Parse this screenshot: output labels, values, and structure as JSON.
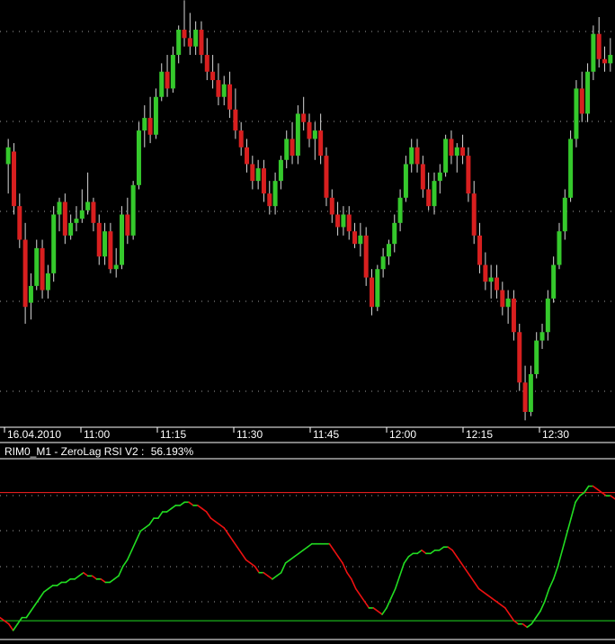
{
  "indicator": {
    "title": "RIM0_M1 - ZeroLag RSI V2 :",
    "value": "56.193%"
  },
  "colors": {
    "background": "#000000",
    "bull": "#35c92c",
    "bear": "#d81f1f",
    "wick": "#d8d8d8",
    "grid": "#c8c8c8",
    "rsi_up": "#22dd22",
    "rsi_down": "#ee1111",
    "level_upper": "#ff2020",
    "level_lower": "#22dd22",
    "axis": "#ffffff"
  },
  "chart_data": [
    {
      "type": "candlestick",
      "symbol": "RIM0",
      "timeframe": "M1",
      "x_tick_labels": [
        "16.04.2010",
        "11:00",
        "11:15",
        "11:30",
        "11:45",
        "12:00",
        "12:15",
        "12:30"
      ],
      "y_axis": "price (unlabeled)",
      "grid": true,
      "ylim": [
        0,
        100
      ],
      "candles": [
        {
          "o": 62,
          "h": 68,
          "l": 55,
          "c": 66
        },
        {
          "o": 65,
          "h": 67,
          "l": 50,
          "c": 52
        },
        {
          "o": 52,
          "h": 55,
          "l": 42,
          "c": 44
        },
        {
          "o": 44,
          "h": 48,
          "l": 24,
          "c": 28
        },
        {
          "o": 29,
          "h": 36,
          "l": 25,
          "c": 33
        },
        {
          "o": 33,
          "h": 44,
          "l": 32,
          "c": 42
        },
        {
          "o": 42,
          "h": 44,
          "l": 30,
          "c": 32
        },
        {
          "o": 32,
          "h": 38,
          "l": 30,
          "c": 36
        },
        {
          "o": 36,
          "h": 52,
          "l": 34,
          "c": 50
        },
        {
          "o": 50,
          "h": 54,
          "l": 46,
          "c": 53
        },
        {
          "o": 53,
          "h": 55,
          "l": 43,
          "c": 45
        },
        {
          "o": 45,
          "h": 50,
          "l": 44,
          "c": 48
        },
        {
          "o": 48,
          "h": 52,
          "l": 46,
          "c": 49
        },
        {
          "o": 49,
          "h": 56,
          "l": 48,
          "c": 51
        },
        {
          "o": 51,
          "h": 60,
          "l": 50,
          "c": 53
        },
        {
          "o": 53,
          "h": 54,
          "l": 46,
          "c": 48
        },
        {
          "o": 48,
          "h": 50,
          "l": 38,
          "c": 40
        },
        {
          "o": 40,
          "h": 48,
          "l": 38,
          "c": 46
        },
        {
          "o": 46,
          "h": 48,
          "l": 36,
          "c": 37
        },
        {
          "o": 37,
          "h": 42,
          "l": 35,
          "c": 38
        },
        {
          "o": 38,
          "h": 52,
          "l": 37,
          "c": 50
        },
        {
          "o": 50,
          "h": 54,
          "l": 43,
          "c": 45
        },
        {
          "o": 45,
          "h": 58,
          "l": 44,
          "c": 57
        },
        {
          "o": 57,
          "h": 72,
          "l": 56,
          "c": 70
        },
        {
          "o": 70,
          "h": 76,
          "l": 66,
          "c": 73
        },
        {
          "o": 73,
          "h": 78,
          "l": 67,
          "c": 69
        },
        {
          "o": 69,
          "h": 80,
          "l": 68,
          "c": 78
        },
        {
          "o": 78,
          "h": 86,
          "l": 77,
          "c": 84
        },
        {
          "o": 84,
          "h": 88,
          "l": 78,
          "c": 80
        },
        {
          "o": 80,
          "h": 90,
          "l": 79,
          "c": 88
        },
        {
          "o": 88,
          "h": 95,
          "l": 86,
          "c": 94
        },
        {
          "o": 94,
          "h": 101,
          "l": 90,
          "c": 92
        },
        {
          "o": 92,
          "h": 98,
          "l": 88,
          "c": 90
        },
        {
          "o": 90,
          "h": 96,
          "l": 88,
          "c": 94
        },
        {
          "o": 94,
          "h": 96,
          "l": 86,
          "c": 88
        },
        {
          "o": 88,
          "h": 92,
          "l": 82,
          "c": 84
        },
        {
          "o": 84,
          "h": 88,
          "l": 80,
          "c": 82
        },
        {
          "o": 82,
          "h": 86,
          "l": 76,
          "c": 78
        },
        {
          "o": 78,
          "h": 83,
          "l": 76,
          "c": 81
        },
        {
          "o": 81,
          "h": 84,
          "l": 73,
          "c": 75
        },
        {
          "o": 75,
          "h": 80,
          "l": 68,
          "c": 70
        },
        {
          "o": 70,
          "h": 72,
          "l": 64,
          "c": 66
        },
        {
          "o": 66,
          "h": 68,
          "l": 60,
          "c": 62
        },
        {
          "o": 62,
          "h": 64,
          "l": 56,
          "c": 58
        },
        {
          "o": 58,
          "h": 63,
          "l": 56,
          "c": 61
        },
        {
          "o": 61,
          "h": 63,
          "l": 53,
          "c": 55
        },
        {
          "o": 55,
          "h": 58,
          "l": 50,
          "c": 52
        },
        {
          "o": 52,
          "h": 60,
          "l": 50,
          "c": 58
        },
        {
          "o": 58,
          "h": 64,
          "l": 56,
          "c": 63
        },
        {
          "o": 63,
          "h": 70,
          "l": 61,
          "c": 68
        },
        {
          "o": 68,
          "h": 72,
          "l": 62,
          "c": 64
        },
        {
          "o": 64,
          "h": 76,
          "l": 62,
          "c": 74
        },
        {
          "o": 74,
          "h": 78,
          "l": 70,
          "c": 72
        },
        {
          "o": 72,
          "h": 74,
          "l": 66,
          "c": 68
        },
        {
          "o": 68,
          "h": 72,
          "l": 63,
          "c": 70
        },
        {
          "o": 70,
          "h": 74,
          "l": 62,
          "c": 64
        },
        {
          "o": 64,
          "h": 66,
          "l": 52,
          "c": 54
        },
        {
          "o": 54,
          "h": 56,
          "l": 48,
          "c": 50
        },
        {
          "o": 50,
          "h": 53,
          "l": 45,
          "c": 47
        },
        {
          "o": 47,
          "h": 52,
          "l": 45,
          "c": 50
        },
        {
          "o": 50,
          "h": 52,
          "l": 44,
          "c": 46
        },
        {
          "o": 46,
          "h": 48,
          "l": 42,
          "c": 43
        },
        {
          "o": 43,
          "h": 48,
          "l": 40,
          "c": 45
        },
        {
          "o": 45,
          "h": 47,
          "l": 33,
          "c": 35
        },
        {
          "o": 35,
          "h": 37,
          "l": 26,
          "c": 28
        },
        {
          "o": 28,
          "h": 38,
          "l": 27,
          "c": 37
        },
        {
          "o": 37,
          "h": 42,
          "l": 35,
          "c": 40
        },
        {
          "o": 40,
          "h": 44,
          "l": 38,
          "c": 43
        },
        {
          "o": 43,
          "h": 50,
          "l": 41,
          "c": 48
        },
        {
          "o": 48,
          "h": 56,
          "l": 46,
          "c": 54
        },
        {
          "o": 54,
          "h": 64,
          "l": 53,
          "c": 62
        },
        {
          "o": 62,
          "h": 68,
          "l": 60,
          "c": 66
        },
        {
          "o": 66,
          "h": 68,
          "l": 60,
          "c": 62
        },
        {
          "o": 62,
          "h": 64,
          "l": 54,
          "c": 56
        },
        {
          "o": 56,
          "h": 60,
          "l": 51,
          "c": 52
        },
        {
          "o": 52,
          "h": 60,
          "l": 50,
          "c": 58
        },
        {
          "o": 58,
          "h": 62,
          "l": 55,
          "c": 60
        },
        {
          "o": 60,
          "h": 69,
          "l": 59,
          "c": 68
        },
        {
          "o": 68,
          "h": 70,
          "l": 62,
          "c": 64
        },
        {
          "o": 64,
          "h": 67,
          "l": 60,
          "c": 66
        },
        {
          "o": 66,
          "h": 69,
          "l": 62,
          "c": 64
        },
        {
          "o": 64,
          "h": 66,
          "l": 53,
          "c": 55
        },
        {
          "o": 55,
          "h": 58,
          "l": 43,
          "c": 45
        },
        {
          "o": 45,
          "h": 48,
          "l": 36,
          "c": 38
        },
        {
          "o": 38,
          "h": 41,
          "l": 32,
          "c": 34
        },
        {
          "o": 34,
          "h": 38,
          "l": 30,
          "c": 35
        },
        {
          "o": 35,
          "h": 38,
          "l": 30,
          "c": 32
        },
        {
          "o": 32,
          "h": 34,
          "l": 26,
          "c": 28
        },
        {
          "o": 28,
          "h": 32,
          "l": 24,
          "c": 30
        },
        {
          "o": 30,
          "h": 32,
          "l": 20,
          "c": 22
        },
        {
          "o": 22,
          "h": 24,
          "l": 8,
          "c": 10
        },
        {
          "o": 10,
          "h": 14,
          "l": 1,
          "c": 3
        },
        {
          "o": 3,
          "h": 14,
          "l": 2,
          "c": 12
        },
        {
          "o": 12,
          "h": 22,
          "l": 11,
          "c": 20
        },
        {
          "o": 20,
          "h": 24,
          "l": 18,
          "c": 22
        },
        {
          "o": 22,
          "h": 32,
          "l": 20,
          "c": 30
        },
        {
          "o": 30,
          "h": 40,
          "l": 29,
          "c": 38
        },
        {
          "o": 38,
          "h": 48,
          "l": 37,
          "c": 46
        },
        {
          "o": 46,
          "h": 56,
          "l": 44,
          "c": 54
        },
        {
          "o": 54,
          "h": 70,
          "l": 53,
          "c": 68
        },
        {
          "o": 68,
          "h": 82,
          "l": 66,
          "c": 80
        },
        {
          "o": 80,
          "h": 84,
          "l": 72,
          "c": 74
        },
        {
          "o": 74,
          "h": 86,
          "l": 72,
          "c": 84
        },
        {
          "o": 84,
          "h": 95,
          "l": 82,
          "c": 93
        },
        {
          "o": 93,
          "h": 97,
          "l": 85,
          "c": 87
        },
        {
          "o": 87,
          "h": 90,
          "l": 84,
          "c": 86
        },
        {
          "o": 86,
          "h": 92,
          "l": 84,
          "c": 88
        }
      ]
    },
    {
      "type": "line",
      "name": "ZeroLag RSI V2",
      "last_value": 56.193,
      "levels": [
        70,
        30
      ],
      "ylim": [
        25,
        80
      ],
      "grid": true,
      "values": [
        31,
        30,
        29,
        27,
        29,
        31,
        31,
        33,
        35,
        37,
        39,
        40,
        41,
        41,
        42,
        42,
        43,
        43,
        44,
        45,
        44,
        44,
        43,
        43,
        42,
        42,
        43,
        44,
        47,
        49,
        52,
        55,
        58,
        59,
        60,
        62,
        62,
        64,
        64,
        65,
        66,
        66,
        67,
        67,
        66,
        66,
        65,
        64,
        62,
        61,
        60,
        59,
        57,
        55,
        53,
        51,
        49,
        48,
        47,
        45,
        45,
        44,
        43,
        44,
        45,
        48,
        49,
        50,
        51,
        52,
        53,
        54,
        54,
        54,
        54,
        54,
        52,
        50,
        48,
        45,
        43,
        40,
        38,
        36,
        34,
        34,
        33,
        32,
        34,
        37,
        40,
        44,
        48,
        50,
        51,
        51,
        52,
        51,
        51,
        52,
        52,
        53,
        53,
        52,
        50,
        48,
        46,
        44,
        42,
        40,
        39,
        38,
        37,
        36,
        35,
        34,
        32,
        30,
        29,
        29,
        28,
        29,
        31,
        33,
        36,
        40,
        43,
        47,
        52,
        57,
        62,
        67,
        69,
        70,
        72,
        72,
        71,
        70,
        69,
        69,
        68
      ]
    }
  ]
}
